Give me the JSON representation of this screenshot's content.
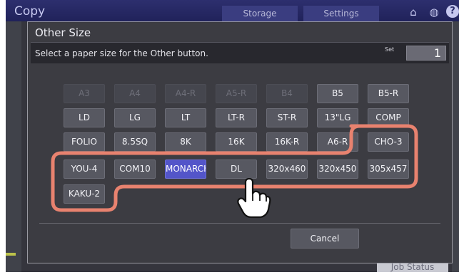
{
  "app": {
    "title": "Copy",
    "tabs": [
      "Storage",
      "Settings"
    ],
    "job_status": "Job Status"
  },
  "dialog": {
    "title": "Other Size",
    "instruction": "Select a paper size for the Other button.",
    "set_label": "Set",
    "set_value": "1",
    "cancel_label": "Cancel"
  },
  "sizes": {
    "row1": [
      "A3",
      "A4",
      "A4-R",
      "A5-R",
      "B4",
      "B5",
      "B5-R"
    ],
    "row2": [
      "LD",
      "LG",
      "LT",
      "LT-R",
      "ST-R",
      "13\"LG",
      "COMP"
    ],
    "row3": [
      "FOLIO",
      "8.5SQ",
      "8K",
      "16K",
      "16K-R",
      "A6-R",
      "CHO-3"
    ],
    "row4": [
      "YOU-4",
      "COM10",
      "MONARCH",
      "DL",
      "320x460",
      "320x450",
      "305x457"
    ],
    "row5": [
      "KAKU-2"
    ],
    "selected": "MONARCH"
  },
  "colors": {
    "selected_button": "#5355c9",
    "highlight_outline": "#e8826f",
    "header": "#2d2f6e"
  },
  "icons": [
    "home-icon",
    "globe-icon",
    "help-icon",
    "pointing-hand-icon"
  ]
}
